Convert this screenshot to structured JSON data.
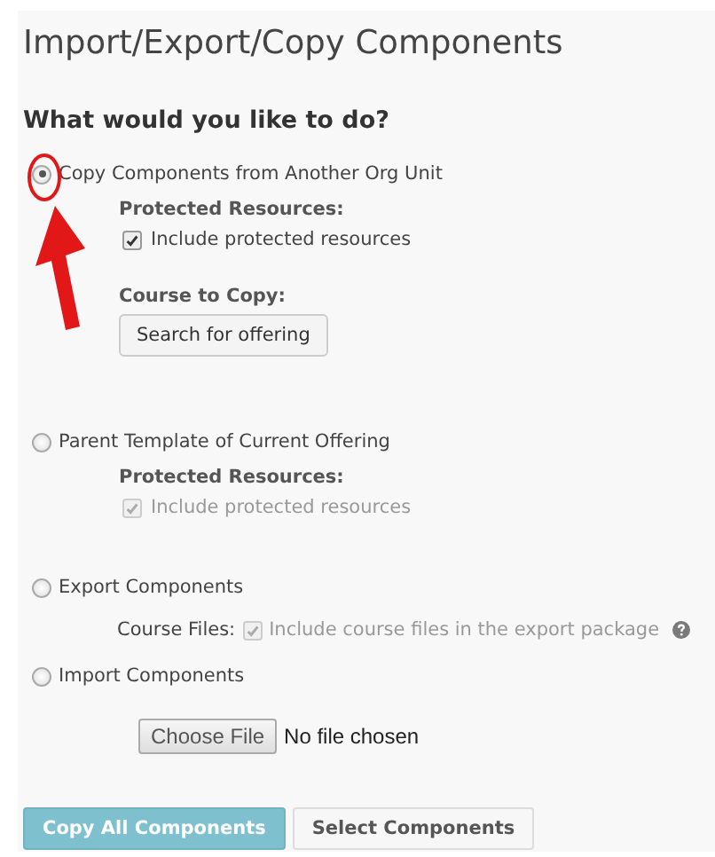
{
  "title": "Import/Export/Copy Components",
  "question": "What would you like to do?",
  "options": [
    {
      "label": "Copy Components from Another Org Unit",
      "selected": true,
      "protected": {
        "heading": "Protected Resources:",
        "checkbox": {
          "label": "Include protected resources",
          "checked": true,
          "disabled": false
        }
      },
      "course": {
        "heading": "Course to Copy:",
        "button": "Search for offering"
      }
    },
    {
      "label": "Parent Template of Current Offering",
      "selected": false,
      "protected": {
        "heading": "Protected Resources:",
        "checkbox": {
          "label": "Include protected resources",
          "checked": true,
          "disabled": true
        }
      }
    },
    {
      "label": "Export Components",
      "selected": false,
      "course_files": {
        "label": "Course Files:",
        "checkbox": {
          "label": "Include course files in the export package",
          "checked": true,
          "disabled": true
        }
      }
    },
    {
      "label": "Import Components",
      "selected": false,
      "file": {
        "button": "Choose File",
        "status": "No file chosen"
      }
    }
  ],
  "actions": [
    {
      "label": "Copy All Components",
      "kind": "primary"
    },
    {
      "label": "Select Components",
      "kind": "secondary"
    }
  ]
}
